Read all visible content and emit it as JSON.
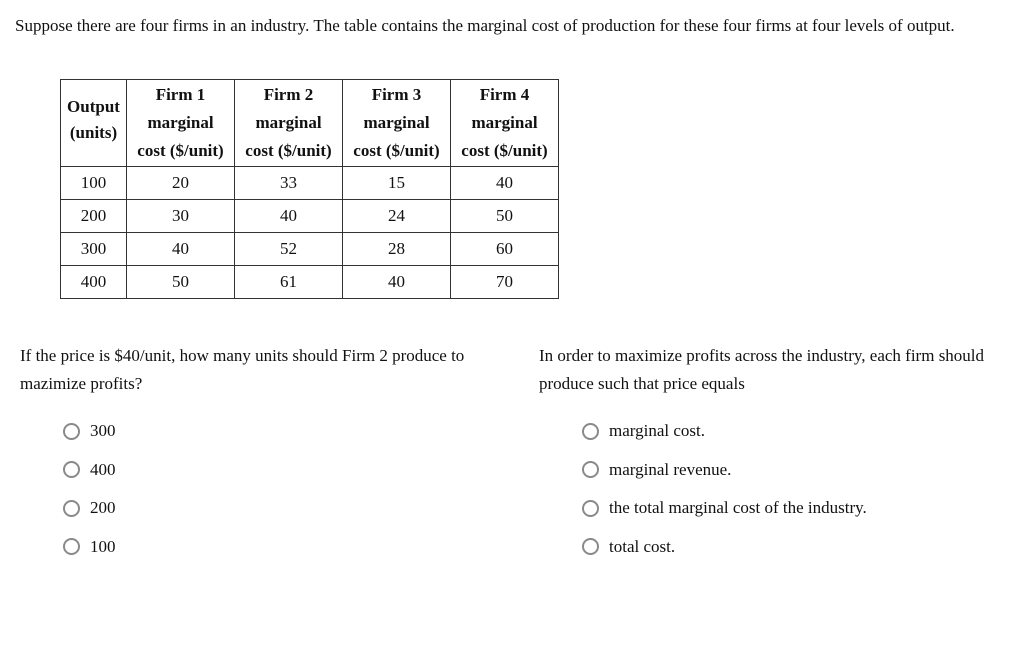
{
  "intro": "Suppose there are four firms in an industry. The table contains the marginal cost of production for these four firms at four levels of output.",
  "table": {
    "headers": {
      "output": [
        "Output",
        "(units)"
      ],
      "firms": [
        {
          "name": "Firm 1",
          "line2": "marginal",
          "line3": "cost ($/unit)"
        },
        {
          "name": "Firm 2",
          "line2": "marginal",
          "line3": "cost ($/unit)"
        },
        {
          "name": "Firm 3",
          "line2": "marginal",
          "line3": "cost ($/unit)"
        },
        {
          "name": "Firm 4",
          "line2": "marginal",
          "line3": "cost ($/unit)"
        }
      ]
    },
    "rows": [
      {
        "output": "100",
        "values": [
          "20",
          "33",
          "15",
          "40"
        ]
      },
      {
        "output": "200",
        "values": [
          "30",
          "40",
          "24",
          "50"
        ]
      },
      {
        "output": "300",
        "values": [
          "40",
          "52",
          "28",
          "60"
        ]
      },
      {
        "output": "400",
        "values": [
          "50",
          "61",
          "40",
          "70"
        ]
      }
    ]
  },
  "questions": [
    {
      "prompt": "If the price is $40/unit, how many units should Firm 2 produce to mazimize profits?",
      "options": [
        "300",
        "400",
        "200",
        "100"
      ],
      "selected": null
    },
    {
      "prompt": "In order to maximize profits across the industry, each firm should produce such that price equals",
      "options": [
        "marginal cost.",
        "marginal revenue.",
        "the total marginal cost of the industry.",
        "total cost."
      ],
      "selected": null
    }
  ]
}
